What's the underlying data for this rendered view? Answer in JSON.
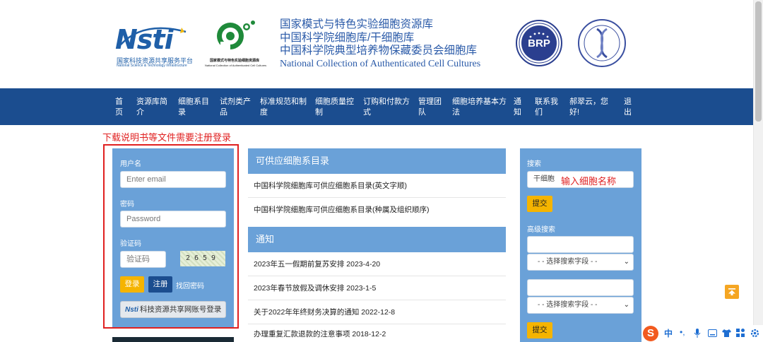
{
  "header": {
    "nsti_logo_text": "Nsti",
    "nsti_cn": "国家科技资源共享服务平台",
    "nsti_en": "National Science & Technology Infrastructure",
    "ncac_cn": "国家模式与特色实验细胞资源库",
    "ncac_en": "National Collection of Authenticated Cell Cultures",
    "title_lines": [
      "国家模式与特色实验细胞资源库",
      "中国科学院细胞库/干细胞库",
      "中国科学院典型培养物保藏委员会细胞库",
      "National Collection of Authenticated Cell Cultures"
    ],
    "brp_text": "BRP"
  },
  "nav": {
    "items": [
      "首页",
      "资源库简介",
      "细胞系目录",
      "试剂类产品",
      "标准规范和制度",
      "细胞质量控制",
      "订购和付款方式",
      "管理团队",
      "细胞培养基本方法",
      "通知",
      "联系我们",
      "郝翠云，您好!",
      "退出"
    ]
  },
  "annotations": {
    "login_note": "下载说明书等文件需要注册登录",
    "search_note": "输入细胞名称"
  },
  "login": {
    "username_label": "用户名",
    "username_placeholder": "Enter email",
    "password_label": "密码",
    "password_placeholder": "Password",
    "captcha_label": "验证码",
    "captcha_placeholder": "验证码",
    "captcha_image_text": "2659",
    "login_button": "登录",
    "register_button": "注册",
    "forgot_link": "找回密码",
    "cstnet_button": "科技资源共享网账号登录",
    "cstnet_logo": "Nsti"
  },
  "catalog": {
    "heading": "可供应细胞系目录",
    "items": [
      "中国科学院细胞库可供应细胞系目录(英文字顺)",
      "中国科学院细胞库可供应细胞系目录(种属及组织顺序)"
    ]
  },
  "notices": {
    "heading": "通知",
    "items": [
      "2023年五一假期前复苏安排 2023-4-20",
      "2023年春节放假及调休安排 2023-1-5",
      "关于2022年年终财务决算的通知 2022-12-8",
      "办理重复汇款退款的注意事项 2018-12-2"
    ]
  },
  "search": {
    "label": "搜索",
    "input_value": "干细胞",
    "submit_label": "提交",
    "advanced_label": "高级搜索",
    "select_placeholder": "- - 选择搜索字段 - -",
    "submit_label_2": "提交"
  },
  "ime": {
    "logo": "S",
    "lang": "中"
  },
  "colors": {
    "nav_bg": "#1b4d8f",
    "panel_bg": "#6aa1d8",
    "accent_yellow": "#f5b400",
    "annotation_red": "#e02020",
    "title_blue": "#2a5aa8"
  }
}
